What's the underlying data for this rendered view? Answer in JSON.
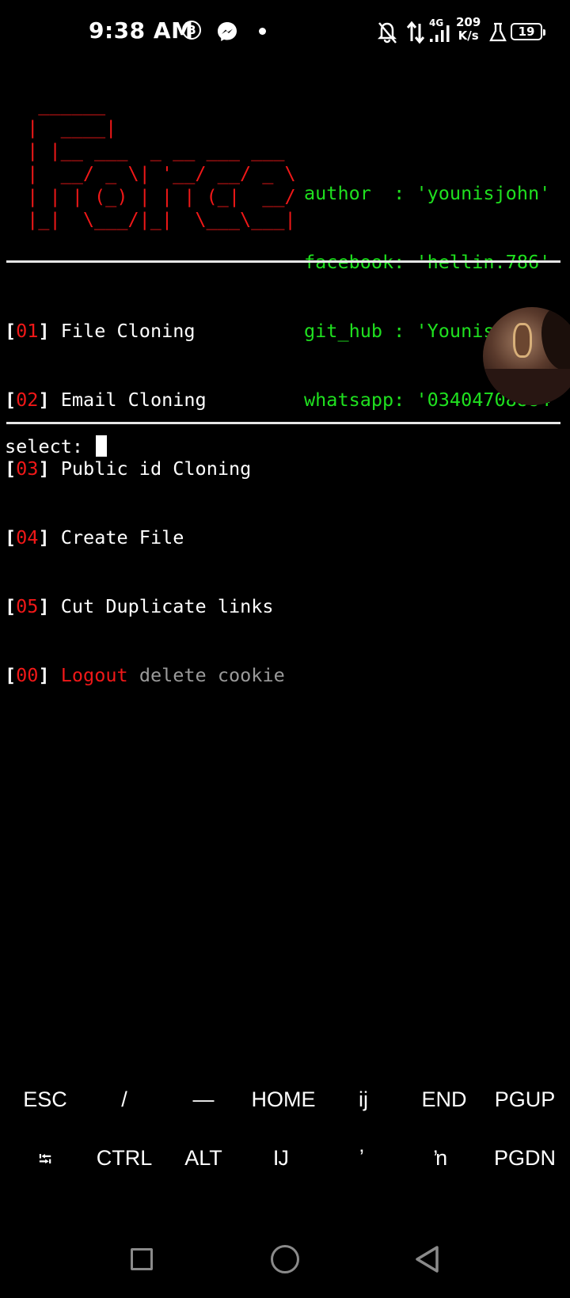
{
  "status_bar": {
    "time": "9:38 AM",
    "b_badge": "B",
    "network_type": "4G",
    "speed_value": "209",
    "speed_unit": "K/s",
    "battery": "19",
    "icons": [
      "b-badge-icon",
      "messenger-icon",
      "notification-dot-icon",
      "bell-off-icon",
      "data-arrows-icon",
      "signal-icon",
      "lab-flask-icon",
      "battery-icon"
    ]
  },
  "terminal": {
    "banner_ascii": "  ______\n |  ____|\n | |__ ___  _ __ ___ ___\n |  __/ _ \\| '__/ __/ _ \\\n | | | (_) | | | (_|  __/\n |_|  \\___/|_|  \\___\\___|",
    "info": [
      "author  : 'younisjohn'",
      "facebook: 'hellin.786'",
      "git_hub : 'YounisJohn'",
      "whatsapp: '03404708884'"
    ],
    "menu": [
      {
        "num": "01",
        "label": "File Cloning"
      },
      {
        "num": "02",
        "label": "Email Cloning"
      },
      {
        "num": "03",
        "label": "Public id Cloning"
      },
      {
        "num": "04",
        "label": "Create File"
      },
      {
        "num": "05",
        "label": "Cut Duplicate links"
      },
      {
        "num": "00",
        "label": "Logout",
        "extra": "delete cookie"
      }
    ],
    "prompt": "select: ",
    "colors": {
      "accent_red": "#f01818",
      "accent_green": "#1fe01f",
      "muted": "#9a9a9a"
    }
  },
  "extra_keys": {
    "row1": [
      "ESC",
      "/",
      "—",
      "HOME",
      "ij",
      "END",
      "PGUP"
    ],
    "row2": [
      "⭾",
      "CTRL",
      "ALT",
      "Ĳ",
      "ʼ",
      "ŉ",
      "PGDN"
    ]
  },
  "nav": {
    "icons": [
      "recent-apps-icon",
      "home-icon",
      "back-icon"
    ]
  }
}
